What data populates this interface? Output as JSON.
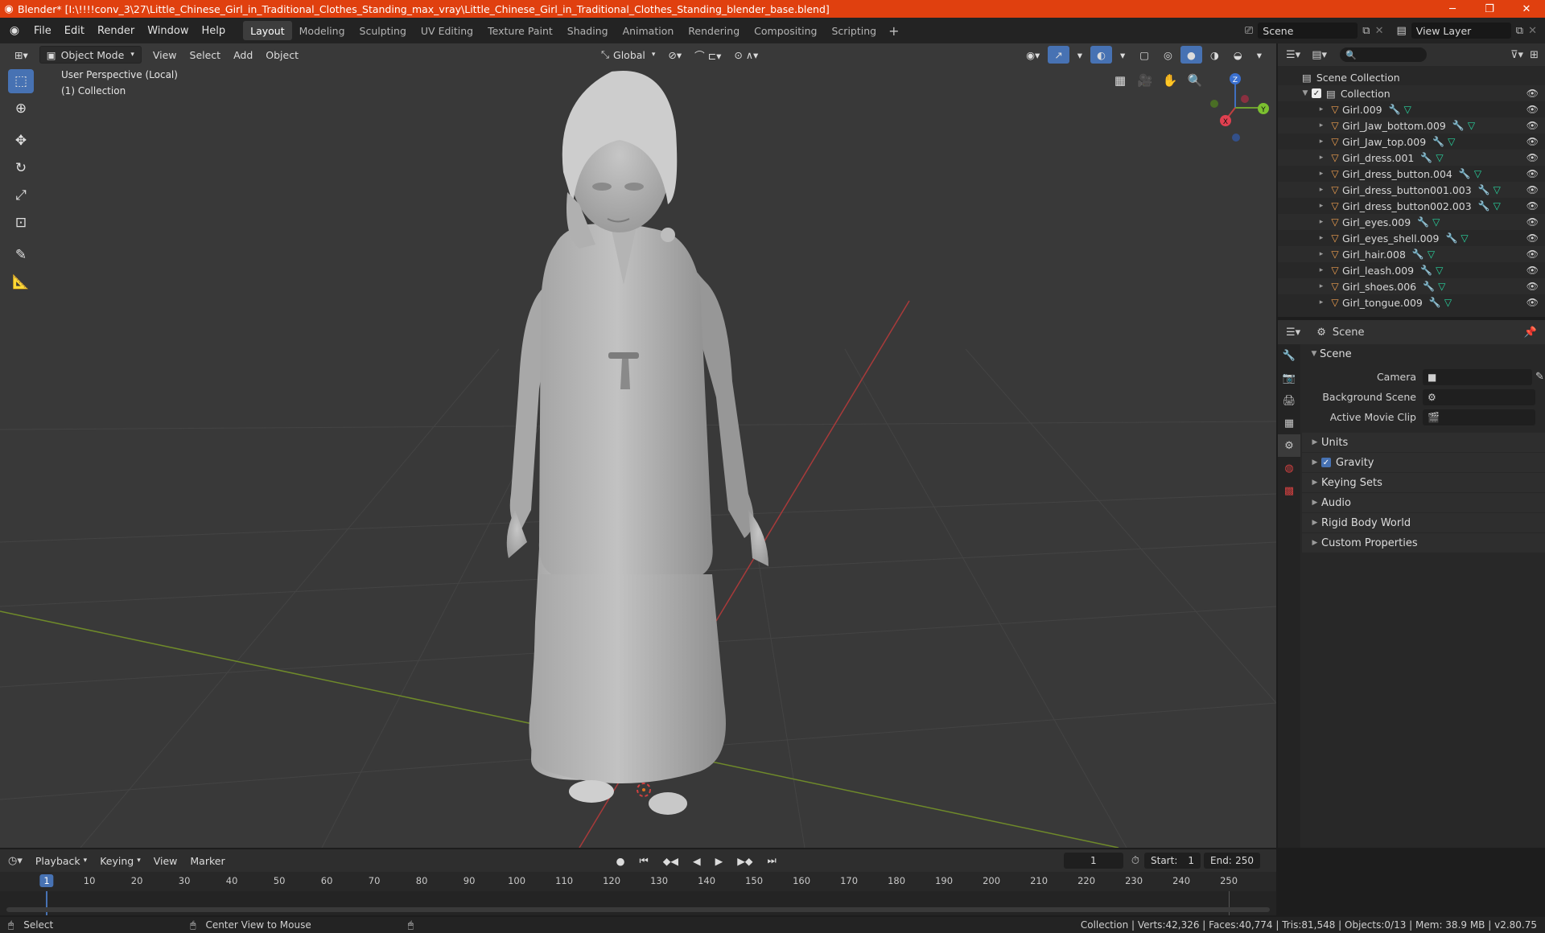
{
  "titlebar": {
    "title": "Blender* [I:\\!!!!conv_3\\27\\Little_Chinese_Girl_in_Traditional_Clothes_Standing_max_vray\\Little_Chinese_Girl_in_Traditional_Clothes_Standing_blender_base.blend]"
  },
  "menu": {
    "items": [
      "File",
      "Edit",
      "Render",
      "Window",
      "Help"
    ],
    "workspaces": [
      "Layout",
      "Modeling",
      "Sculpting",
      "UV Editing",
      "Texture Paint",
      "Shading",
      "Animation",
      "Rendering",
      "Compositing",
      "Scripting"
    ],
    "active_workspace": "Layout",
    "scene": "Scene",
    "view_layer": "View Layer"
  },
  "viewport": {
    "mode": "Object Mode",
    "header_menus": [
      "View",
      "Select",
      "Add",
      "Object"
    ],
    "orientation": "Global",
    "overlay_line1": "User Perspective (Local)",
    "overlay_line2": "(1) Collection",
    "gizmo": {
      "x": "X",
      "y": "Y",
      "z": "Z"
    }
  },
  "outliner": {
    "root": "Scene Collection",
    "collection": "Collection",
    "objects": [
      "Girl.009",
      "Girl_Jaw_bottom.009",
      "Girl_Jaw_top.009",
      "Girl_dress.001",
      "Girl_dress_button.004",
      "Girl_dress_button001.003",
      "Girl_dress_button002.003",
      "Girl_eyes.009",
      "Girl_eyes_shell.009",
      "Girl_hair.008",
      "Girl_leash.009",
      "Girl_shoes.006",
      "Girl_tongue.009"
    ]
  },
  "properties": {
    "header": "Scene",
    "panel_title": "Scene",
    "fields": [
      {
        "label": "Camera",
        "value": ""
      },
      {
        "label": "Background Scene",
        "value": ""
      },
      {
        "label": "Active Movie Clip",
        "value": ""
      }
    ],
    "subpanels": [
      "Units",
      "Gravity",
      "Keying Sets",
      "Audio",
      "Rigid Body World",
      "Custom Properties"
    ]
  },
  "timeline": {
    "menus": [
      "Playback",
      "Keying",
      "View",
      "Marker"
    ],
    "current_frame": "1",
    "start_label": "Start:",
    "start": "1",
    "end_label": "End:",
    "end": "250",
    "ticks": [
      "10",
      "20",
      "30",
      "40",
      "50",
      "60",
      "70",
      "80",
      "90",
      "100",
      "110",
      "120",
      "130",
      "140",
      "150",
      "160",
      "170",
      "180",
      "190",
      "200",
      "210",
      "220",
      "230",
      "240",
      "250"
    ]
  },
  "statusbar": {
    "left_action": "Select",
    "mid_action": "Center View to Mouse",
    "stats": "Collection | Verts:42,326 | Faces:40,774 | Tris:81,548 | Objects:0/13 | Mem: 38.9 MB | v2.80.75"
  },
  "colors": {
    "titlebar": "#e0400f",
    "accent": "#4772b3",
    "object_icon": "#f0a050",
    "mesh_icon": "#28d6a0"
  }
}
